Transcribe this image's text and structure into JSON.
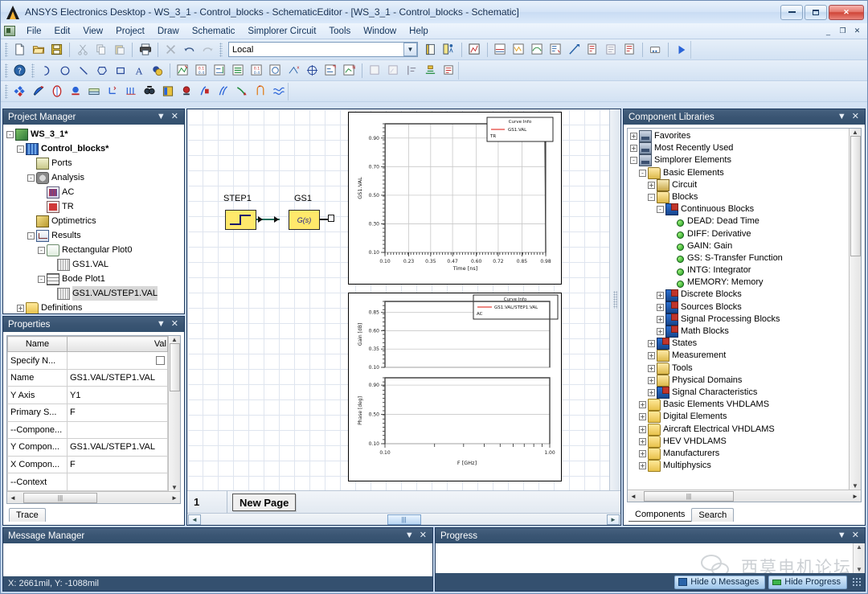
{
  "window": {
    "title": "ANSYS Electronics Desktop - WS_3_1 - Control_blocks - SchematicEditor - [WS_3_1 - Control_blocks - Schematic]",
    "minimize_label": "Minimize",
    "maximize_label": "Maximize",
    "close_label": "Close",
    "mdi_minimize": "_",
    "mdi_restore": "❐",
    "mdi_close": "✕"
  },
  "menubar": {
    "items": [
      "File",
      "Edit",
      "View",
      "Project",
      "Draw",
      "Schematic",
      "Simplorer Circuit",
      "Tools",
      "Window",
      "Help"
    ]
  },
  "toolbar": {
    "context_combo_value": "Local",
    "row1_icons": [
      "new-file-icon",
      "open-folder-icon",
      "save-icon",
      "cut-icon",
      "copy-icon",
      "paste-icon",
      "print-icon",
      "delete-icon",
      "undo-icon",
      "redo-icon"
    ],
    "row1_icons_right": [
      "notebook-icon",
      "validate-icon",
      "analyze-icon",
      "results-icon",
      "tr-analysis-icon",
      "ac-analysis-icon",
      "dc-analysis-icon",
      "report-icon",
      "add-marker-icon",
      "output-variable-icon",
      "design-settings-icon",
      "solution-setup-icon",
      "mesh-icon",
      "run-icon"
    ],
    "row2_icons": [
      "help-icon",
      "arc-icon",
      "circle-icon",
      "line-icon",
      "polygon-icon",
      "rectangle-icon",
      "text-icon",
      "color-fill-icon",
      "zoom-fit-icon",
      "zoom-in-icon",
      "zoom-out-icon",
      "pan-icon",
      "zoom-area-icon",
      "rotate-icon",
      "center-icon",
      "fit-selection-icon",
      "measure-icon"
    ],
    "row3_icons": [
      "add-component-icon",
      "wire-icon",
      "port-icon",
      "ground-icon",
      "page-icon",
      "add-pin-icon",
      "add-bus-icon",
      "probe-icon",
      "subcircuit-icon",
      "edit-symbol-icon",
      "edit-component-icon",
      "place-wire-icon",
      "pin-connect-icon",
      "signal-icon",
      "waveform-icon"
    ]
  },
  "project_manager": {
    "title": "Project Manager",
    "pin_label": "▾",
    "close_label": "✕",
    "tree": [
      {
        "label": "WS_3_1*",
        "level": 0,
        "expander": "-",
        "icon": "project-icon",
        "bold": true
      },
      {
        "label": "Control_blocks*",
        "level": 1,
        "expander": "-",
        "icon": "design-icon",
        "bold": true
      },
      {
        "label": "Ports",
        "level": 2,
        "expander": "",
        "icon": "ports-icon",
        "bold": false
      },
      {
        "label": "Analysis",
        "level": 2,
        "expander": "-",
        "icon": "analysis-icon",
        "bold": false
      },
      {
        "label": "AC",
        "level": 3,
        "expander": "",
        "icon": "ac-setup-icon",
        "bold": false
      },
      {
        "label": "TR",
        "level": 3,
        "expander": "",
        "icon": "tr-setup-icon",
        "bold": false
      },
      {
        "label": "Optimetrics",
        "level": 2,
        "expander": "",
        "icon": "optimetrics-icon",
        "bold": false
      },
      {
        "label": "Results",
        "level": 2,
        "expander": "-",
        "icon": "results-icon",
        "bold": false
      },
      {
        "label": "Rectangular Plot0",
        "level": 3,
        "expander": "-",
        "icon": "rect-plot-icon",
        "bold": false
      },
      {
        "label": "GS1.VAL",
        "level": 4,
        "expander": "",
        "icon": "trace-icon",
        "bold": false
      },
      {
        "label": "Bode Plot1",
        "level": 3,
        "expander": "-",
        "icon": "bode-plot-icon",
        "bold": false
      },
      {
        "label": "GS1.VAL/STEP1.VAL",
        "level": 4,
        "expander": "",
        "icon": "trace-icon",
        "bold": false,
        "selected": true
      },
      {
        "label": "Definitions",
        "level": 1,
        "expander": "+",
        "icon": "folder-icon",
        "bold": false
      }
    ]
  },
  "properties": {
    "title": "Properties",
    "pin_label": "▾",
    "close_label": "✕",
    "columns": [
      "Name",
      "Val"
    ],
    "rows": [
      {
        "name": "Specify N...",
        "value": "",
        "checkbox": true
      },
      {
        "name": "Name",
        "value": "GS1.VAL/STEP1.VAL"
      },
      {
        "name": "Y Axis",
        "value": "Y1"
      },
      {
        "name": "Primary S...",
        "value": "F"
      },
      {
        "name": "--Compone...",
        "value": ""
      },
      {
        "name": "Y Compon...",
        "value": "GS1.VAL/STEP1.VAL"
      },
      {
        "name": "X Compon...",
        "value": "F"
      },
      {
        "name": "--Context",
        "value": ""
      }
    ],
    "tab": "Trace",
    "scroll_up": "▲",
    "scroll_down": "▼",
    "scroll_left": "◄",
    "scroll_right": "►"
  },
  "schematic": {
    "page_number": "1",
    "new_page_label": "New Page",
    "blocks": [
      {
        "name": "STEP1",
        "glyph": "step"
      },
      {
        "name": "GS1",
        "glyph": "G(s)"
      }
    ],
    "scroll_left": "◄",
    "scroll_right": "►"
  },
  "chart_data": [
    {
      "type": "line",
      "name": "Rectangular Plot0",
      "title": "",
      "xlabel": "Time [ns]",
      "ylabel": "GS1.VAL",
      "xlim": [
        0.1,
        0.98
      ],
      "ylim": [
        0.1,
        1.0
      ],
      "xticks": [
        "0.10",
        "0.23",
        "0.35",
        "0.47",
        "0.60",
        "0.72",
        "0.85",
        "0.98"
      ],
      "yticks": [
        "0.10",
        "0.30",
        "0.50",
        "0.70",
        "0.90"
      ],
      "grid": true,
      "legend": {
        "title": "Curve Info",
        "position": "top-right",
        "entries": [
          {
            "label": "GS1.VAL",
            "sublabel": "TR",
            "color": "#e8615a"
          }
        ]
      },
      "series": [
        {
          "name": "GS1.VAL",
          "color": "#444444",
          "x": [
            0.1,
            0.101,
            0.12,
            0.3,
            0.6,
            0.9,
            0.975,
            0.978,
            0.98
          ],
          "y": [
            0.1,
            1.0,
            1.0,
            1.0,
            1.0,
            1.0,
            1.0,
            0.55,
            0.1
          ]
        }
      ]
    },
    {
      "type": "line",
      "name": "Bode Plot1",
      "title": "",
      "xlabel": "F [GHz]",
      "xscale": "log",
      "xlim": [
        0.1,
        1.0
      ],
      "xticks": [
        "0.10",
        "1.00"
      ],
      "grid": true,
      "legend": {
        "title": "Curve Info",
        "position": "top-right",
        "entries": [
          {
            "label": "GS1.VAL/STEP1.VAL",
            "sublabel": "AC",
            "color": "#e8615a"
          }
        ]
      },
      "subplots": [
        {
          "ylabel": "Gain [dB]",
          "ylim": [
            0.1,
            1.0
          ],
          "yticks": [
            "0.10",
            "0.35",
            "0.60",
            "0.85"
          ],
          "series": [
            {
              "name": "GS1.VAL/STEP1.VAL",
              "color": "#444444",
              "x": [
                0.1,
                0.1,
                1.0,
                1.0
              ],
              "y": [
                0.1,
                1.0,
                1.0,
                0.1
              ]
            }
          ]
        },
        {
          "ylabel": "Phase [deg]",
          "ylim": [
            0.1,
            1.0
          ],
          "yticks": [
            "0.10",
            "0.50",
            "0.90"
          ],
          "series": [
            {
              "name": "GS1.VAL/STEP1.VAL",
              "color": "#444444",
              "x": [
                0.1,
                0.1,
                1.0,
                1.0
              ],
              "y": [
                0.1,
                1.0,
                1.0,
                0.1
              ]
            }
          ]
        }
      ]
    }
  ],
  "component_libraries": {
    "title": "Component Libraries",
    "pin_label": "▾",
    "close_label": "✕",
    "tree": [
      {
        "label": "Favorites",
        "level": 0,
        "expander": "+",
        "icon": "library-icon"
      },
      {
        "label": "Most Recently Used",
        "level": 0,
        "expander": "+",
        "icon": "library-icon"
      },
      {
        "label": "Simplorer Elements",
        "level": 0,
        "expander": "-",
        "icon": "library-icon"
      },
      {
        "label": "Basic Elements",
        "level": 1,
        "expander": "-",
        "icon": "folder-open-icon"
      },
      {
        "label": "Circuit",
        "level": 2,
        "expander": "+",
        "icon": "circuit-icon"
      },
      {
        "label": "Blocks",
        "level": 2,
        "expander": "-",
        "icon": "folder-open-icon"
      },
      {
        "label": "Continuous Blocks",
        "level": 3,
        "expander": "-",
        "icon": "blocks-icon"
      },
      {
        "label": "DEAD: Dead Time",
        "level": 4,
        "expander": "",
        "icon": "component-dot-icon"
      },
      {
        "label": "DIFF: Derivative",
        "level": 4,
        "expander": "",
        "icon": "component-dot-icon"
      },
      {
        "label": "GAIN: Gain",
        "level": 4,
        "expander": "",
        "icon": "component-dot-icon"
      },
      {
        "label": "GS: S-Transfer Function",
        "level": 4,
        "expander": "",
        "icon": "component-dot-icon"
      },
      {
        "label": "INTG: Integrator",
        "level": 4,
        "expander": "",
        "icon": "component-dot-icon"
      },
      {
        "label": "MEMORY: Memory",
        "level": 4,
        "expander": "",
        "icon": "component-dot-icon"
      },
      {
        "label": "Discrete Blocks",
        "level": 3,
        "expander": "+",
        "icon": "blocks-icon"
      },
      {
        "label": "Sources Blocks",
        "level": 3,
        "expander": "+",
        "icon": "blocks-icon"
      },
      {
        "label": "Signal Processing Blocks",
        "level": 3,
        "expander": "+",
        "icon": "blocks-icon"
      },
      {
        "label": "Math Blocks",
        "level": 3,
        "expander": "+",
        "icon": "blocks-icon"
      },
      {
        "label": "States",
        "level": 2,
        "expander": "+",
        "icon": "blocks-icon"
      },
      {
        "label": "Measurement",
        "level": 2,
        "expander": "+",
        "icon": "folder-open-icon"
      },
      {
        "label": "Tools",
        "level": 2,
        "expander": "+",
        "icon": "folder-open-icon"
      },
      {
        "label": "Physical Domains",
        "level": 2,
        "expander": "+",
        "icon": "folder-open-icon"
      },
      {
        "label": "Signal Characteristics",
        "level": 2,
        "expander": "+",
        "icon": "blocks-icon"
      },
      {
        "label": "Basic Elements VHDLAMS",
        "level": 1,
        "expander": "+",
        "icon": "folder-icon"
      },
      {
        "label": "Digital Elements",
        "level": 1,
        "expander": "+",
        "icon": "folder-icon"
      },
      {
        "label": "Aircraft Electrical VHDLAMS",
        "level": 1,
        "expander": "+",
        "icon": "folder-icon"
      },
      {
        "label": "HEV VHDLAMS",
        "level": 1,
        "expander": "+",
        "icon": "folder-icon"
      },
      {
        "label": "Manufacturers",
        "level": 1,
        "expander": "+",
        "icon": "folder-icon"
      },
      {
        "label": "Multiphysics",
        "level": 1,
        "expander": "+",
        "icon": "folder-icon"
      }
    ],
    "tabs": [
      "Components",
      "Search"
    ],
    "active_tab": "Components",
    "scroll_up": "▲",
    "scroll_down": "▼",
    "scroll_left": "◄",
    "scroll_right": "►"
  },
  "message_manager": {
    "title": "Message Manager",
    "pin_label": "▾",
    "close_label": "✕",
    "messages": []
  },
  "progress": {
    "title": "Progress",
    "pin_label": "▾",
    "close_label": "✕",
    "scroll_up": "▲",
    "scroll_down": "▼"
  },
  "status": {
    "coordinates": "X: 2661mil, Y: -1088mil",
    "hide_messages_label": "Hide 0 Messages",
    "hide_progress_label": "Hide Progress"
  },
  "watermark": {
    "text": "西莫电机论坛"
  },
  "colors": {
    "panel_header": "#3a5573",
    "accent": "#2a64a8",
    "block_fill": "#ffe96b",
    "curve": "#e8615a",
    "status_bg": "#34506f"
  }
}
